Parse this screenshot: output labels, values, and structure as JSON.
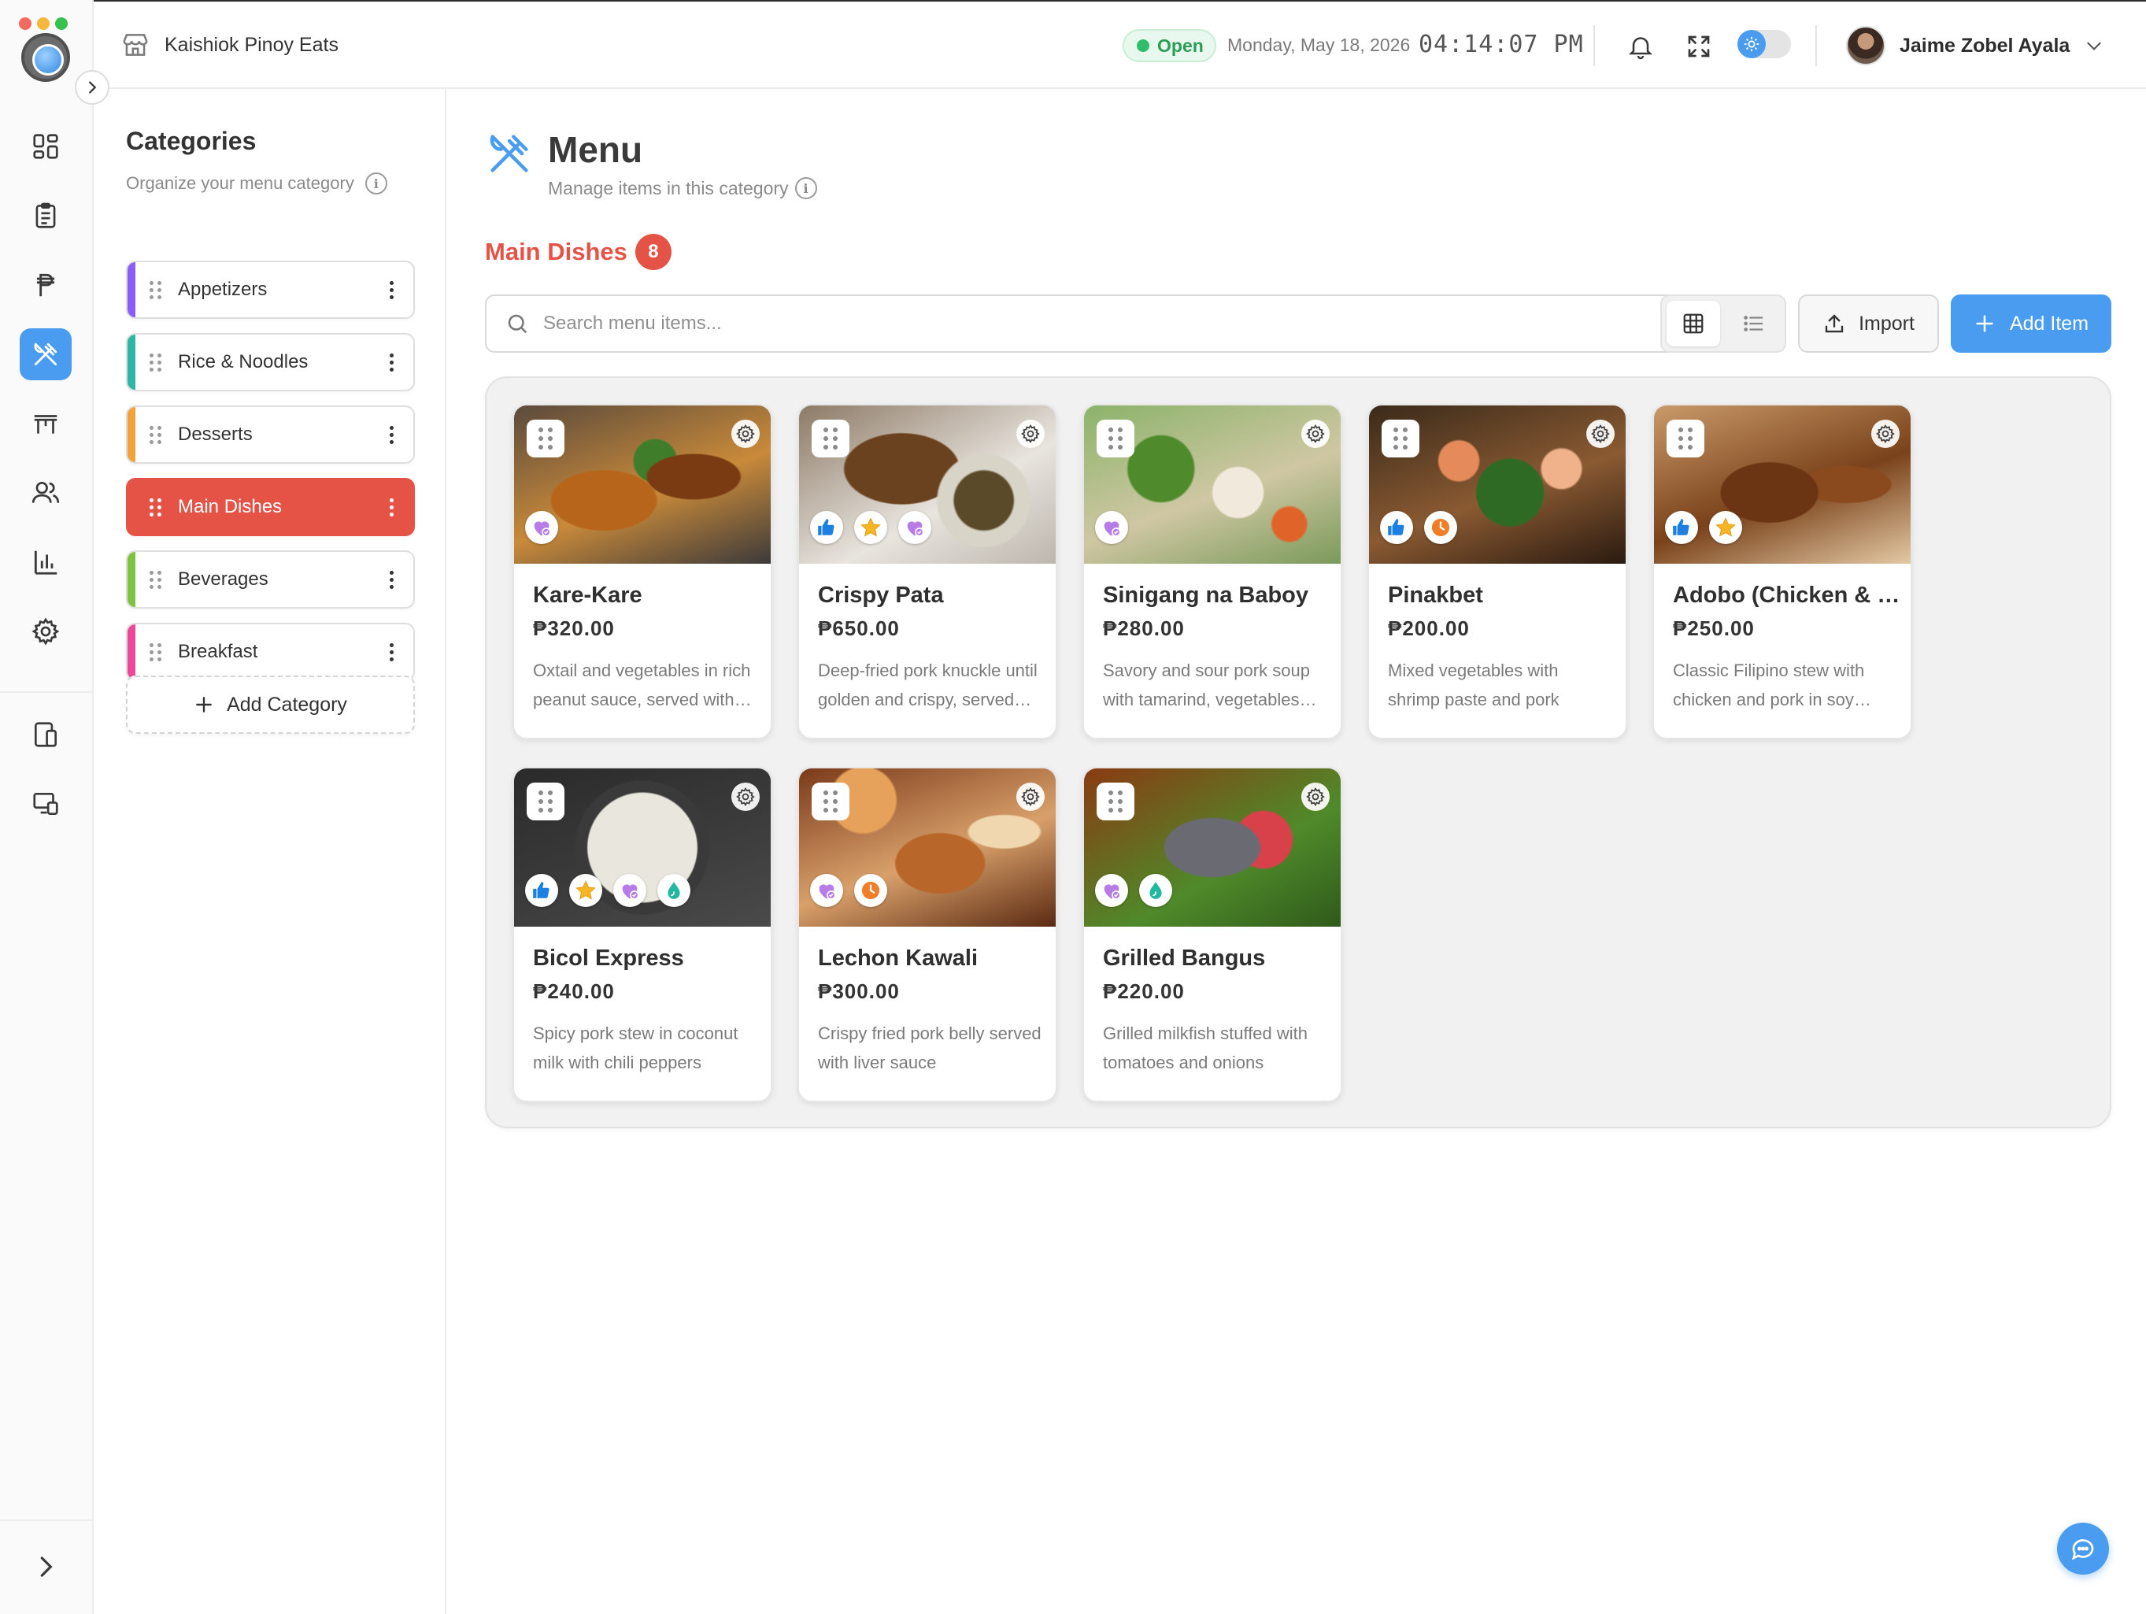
{
  "app": {
    "store_name": "Kaishiok Pinoy Eats",
    "status": "Open",
    "date": "Monday, May 18, 2026",
    "time": "04:14:07 PM",
    "user_name": "Jaime Zobel Ayala"
  },
  "categories_panel": {
    "title": "Categories",
    "subtitle": "Organize your menu category",
    "items": [
      {
        "label": "Appetizers",
        "color": "#8b5cf6"
      },
      {
        "label": "Rice & Noodles",
        "color": "#2fb5a6"
      },
      {
        "label": "Desserts",
        "color": "#f3a13b"
      },
      {
        "label": "Main Dishes",
        "color": "#e55347",
        "active": true
      },
      {
        "label": "Beverages",
        "color": "#7cc440"
      },
      {
        "label": "Breakfast",
        "color": "#ec4899"
      }
    ],
    "add_label": "Add Category"
  },
  "main": {
    "title": "Menu",
    "subtitle": "Manage items in this category",
    "section_title": "Main Dishes",
    "section_count": "8",
    "search_placeholder": "Search menu items...",
    "import_label": "Import",
    "add_item_label": "Add Item",
    "items": [
      {
        "name": "Kare-Kare",
        "price": "₱320.00",
        "desc": "Oxtail and vegetables in rich peanut sauce, served with bagoong",
        "badges": [
          "heart"
        ]
      },
      {
        "name": "Crispy Pata",
        "price": "₱650.00",
        "desc": "Deep-fried pork knuckle until golden and crispy, served with dip",
        "badges": [
          "thumb",
          "star",
          "heart"
        ]
      },
      {
        "name": "Sinigang na Baboy",
        "price": "₱280.00",
        "desc": "Savory and sour pork soup with tamarind, vegetables and chili",
        "badges": [
          "heart"
        ]
      },
      {
        "name": "Pinakbet",
        "price": "₱200.00",
        "desc": "Mixed vegetables with shrimp paste and pork",
        "badges": [
          "thumb",
          "clock"
        ]
      },
      {
        "name": "Adobo (Chicken & Pork)",
        "price": "₱250.00",
        "desc": "Classic Filipino stew with chicken and pork in soy sauce and vinegar",
        "badges": [
          "thumb",
          "star"
        ]
      },
      {
        "name": "Bicol Express",
        "price": "₱240.00",
        "desc": "Spicy pork stew in coconut milk with chili peppers",
        "badges": [
          "thumb",
          "star",
          "heart",
          "drop"
        ]
      },
      {
        "name": "Lechon Kawali",
        "price": "₱300.00",
        "desc": "Crispy fried pork belly served with liver sauce",
        "badges": [
          "heart",
          "clock"
        ]
      },
      {
        "name": "Grilled Bangus",
        "price": "₱220.00",
        "desc": "Grilled milkfish stuffed with tomatoes and onions",
        "badges": [
          "heart",
          "drop"
        ]
      }
    ]
  },
  "colors": {
    "accent_blue": "#4a9cf0",
    "accent_red": "#e55347",
    "open_green": "#2fbf6b"
  }
}
